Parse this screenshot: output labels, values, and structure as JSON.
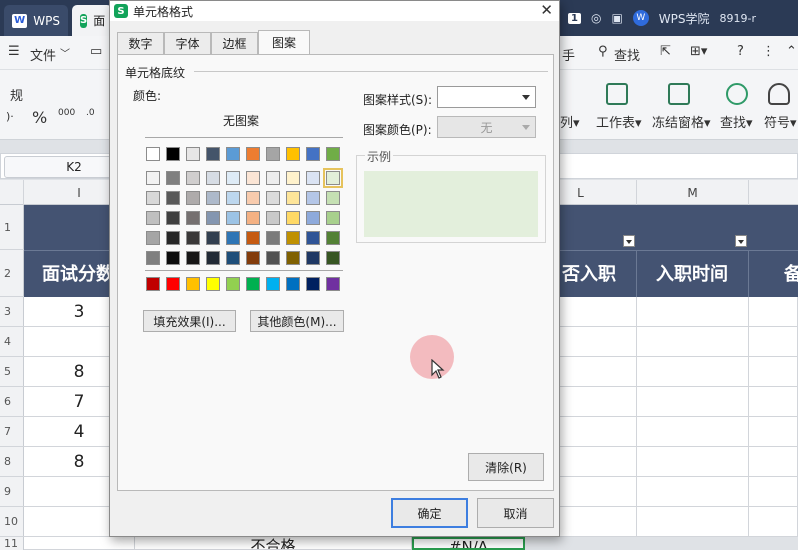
{
  "topbar": {
    "wps_label": "WPS",
    "doc_tab_fragment": "面",
    "wps_college": "WPS学院",
    "phone_fragment": "8919-r",
    "badge": "1"
  },
  "toolbar": {
    "file_menu": "文件",
    "find_label": "查找",
    "help_icon": "?",
    "normal_fragment": "规",
    "percent": "%",
    "hand_fragment": "手",
    "ribbon": [
      "列▾",
      "工作表▾",
      "冻结窗格▾",
      "查找▾",
      "符号▾"
    ]
  },
  "namebox": "K2",
  "columns": {
    "i": "I",
    "l": "L",
    "m": "M"
  },
  "rows": [
    "1",
    "2",
    "3",
    "4",
    "5",
    "6",
    "7",
    "8",
    "9",
    "10",
    "11"
  ],
  "header_row": {
    "interview_score_fragment": "面试分数",
    "hired_fragment": "否入职",
    "join_time": "入职时间",
    "tail": "备"
  },
  "column_i_values": [
    "3",
    "",
    "8",
    "7",
    "4",
    "8",
    "",
    "",
    ""
  ],
  "bottom_row": {
    "fail_text": "不合格",
    "na_text": "#N/A"
  },
  "dialog": {
    "title": "单元格格式",
    "tabs": [
      "数字",
      "字体",
      "边框",
      "图案"
    ],
    "active_tab": "图案",
    "section_label": "单元格底纹",
    "color_label": "颜色:",
    "no_pattern": "无图案",
    "fill_effects_button": "填充效果(I)...",
    "more_colors_button": "其他颜色(M)...",
    "pattern_style_label": "图案样式(S):",
    "pattern_color_label": "图案颜色(P):",
    "pattern_color_value": "无",
    "sample_label": "示例",
    "sample_color": "#e3efdc",
    "clear_button": "清除(R)",
    "ok_button": "确定",
    "cancel_button": "取消"
  },
  "palette": {
    "row0": [
      "#ffffff",
      "#000000",
      "#e7e6e6",
      "#44546a",
      "#5b9bd5",
      "#ed7d31",
      "#a5a5a5",
      "#ffc000",
      "#4472c4",
      "#70ad47"
    ],
    "tints": [
      [
        "#f2f2f2",
        "#7f7f7f",
        "#d0cece",
        "#d6dce4",
        "#deebf6",
        "#fbe5d5",
        "#ededed",
        "#fff2cc",
        "#dae3f3",
        "#e2efd9"
      ],
      [
        "#d8d8d8",
        "#595959",
        "#aeabab",
        "#adb9ca",
        "#bdd7ee",
        "#f8cbad",
        "#dbdbdb",
        "#fee599",
        "#b4c6e7",
        "#c5e0b3"
      ],
      [
        "#bfbfbf",
        "#3f3f3f",
        "#757070",
        "#8496b0",
        "#9cc3e5",
        "#f4b183",
        "#c9c9c9",
        "#ffd965",
        "#8eaadb",
        "#a8d08d"
      ],
      [
        "#a5a5a5",
        "#262626",
        "#3a3838",
        "#323f4f",
        "#2e75b5",
        "#c55a11",
        "#7b7b7b",
        "#bf9000",
        "#2f5496",
        "#538135"
      ],
      [
        "#7f7f7f",
        "#0c0c0c",
        "#171616",
        "#222a35",
        "#1e4e79",
        "#833c0b",
        "#525252",
        "#7f6000",
        "#1f3864",
        "#375623"
      ]
    ],
    "standard": [
      "#c00000",
      "#ff0000",
      "#ffc000",
      "#ffff00",
      "#92d050",
      "#00b050",
      "#00b0f0",
      "#0070c0",
      "#002060",
      "#7030a0"
    ],
    "selected_index": [
      0,
      9
    ]
  }
}
